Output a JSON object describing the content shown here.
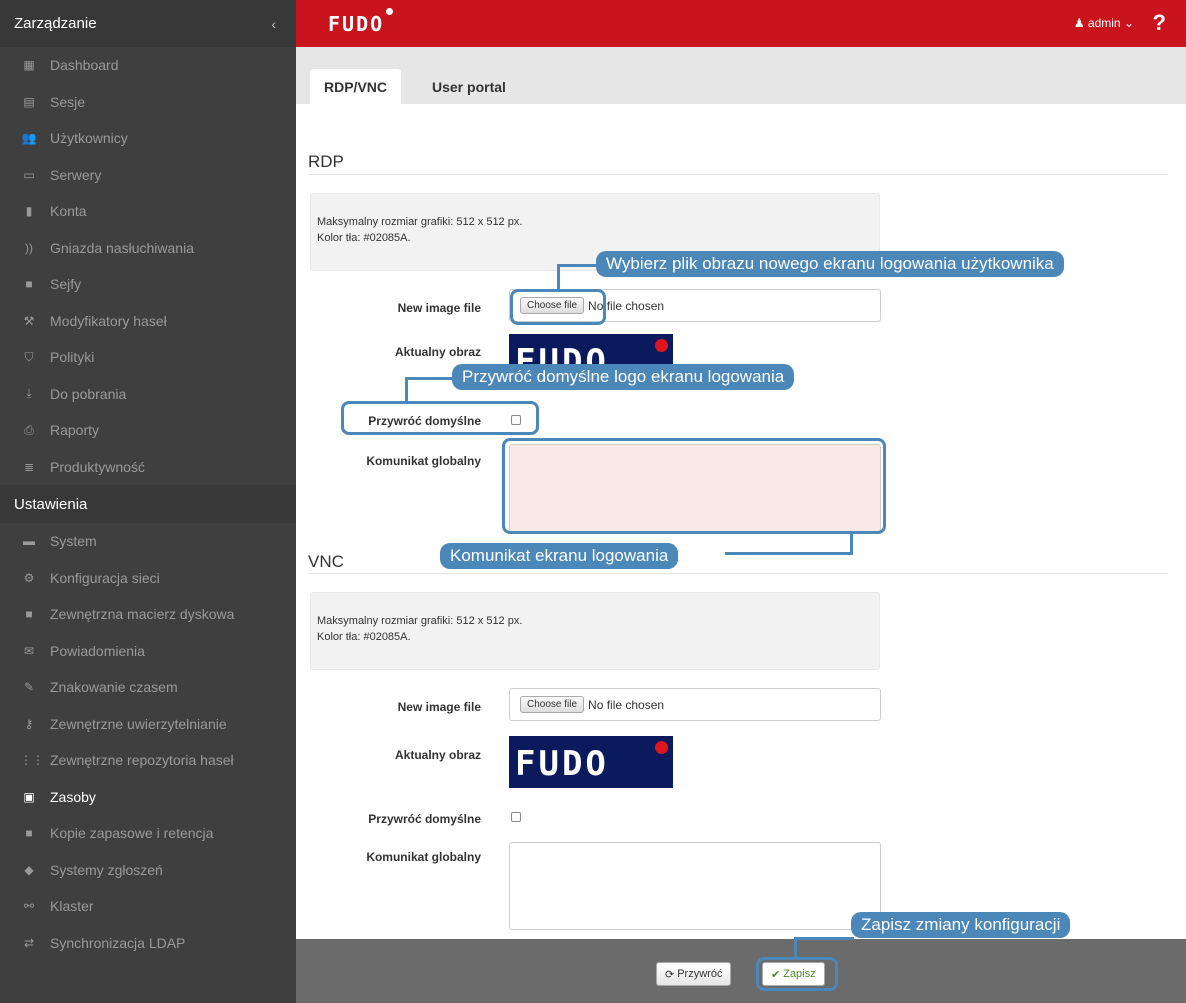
{
  "sidebar": {
    "header": "Zarządzanie",
    "collapse_icon": "‹",
    "management_items": [
      {
        "label": "Dashboard",
        "icon": "▦"
      },
      {
        "label": "Sesje",
        "icon": "▤"
      },
      {
        "label": "Użytkownicy",
        "icon": "👥"
      },
      {
        "label": "Serwery",
        "icon": "▭"
      },
      {
        "label": "Konta",
        "icon": "▮"
      },
      {
        "label": "Gniazda nasłuchiwania",
        "icon": "))"
      },
      {
        "label": "Sejfy",
        "icon": "■"
      },
      {
        "label": "Modyfikatory haseł",
        "icon": "⚒"
      },
      {
        "label": "Polityki",
        "icon": "⛉"
      },
      {
        "label": "Do pobrania",
        "icon": "⤓"
      },
      {
        "label": "Raporty",
        "icon": "⎙"
      },
      {
        "label": "Produktywność",
        "icon": "≣"
      }
    ],
    "settings_header": "Ustawienia",
    "settings_items": [
      {
        "label": "System",
        "icon": "▬"
      },
      {
        "label": "Konfiguracja sieci",
        "icon": "⚙"
      },
      {
        "label": "Zewnętrzna macierz dyskowa",
        "icon": "■"
      },
      {
        "label": "Powiadomienia",
        "icon": "✉"
      },
      {
        "label": "Znakowanie czasem",
        "icon": "✎"
      },
      {
        "label": "Zewnętrzne uwierzytelnianie",
        "icon": "⚷"
      },
      {
        "label": "Zewnętrzne repozytoria haseł",
        "icon": "⋮⋮"
      },
      {
        "label": "Zasoby",
        "icon": "▣"
      },
      {
        "label": "Kopie zapasowe i retencja",
        "icon": "■"
      },
      {
        "label": "Systemy zgłoszeń",
        "icon": "◆"
      },
      {
        "label": "Klaster",
        "icon": "⚯"
      },
      {
        "label": "Synchronizacja LDAP",
        "icon": "⇄"
      }
    ]
  },
  "topbar": {
    "logo": "FUDO",
    "user": "♟ admin ⌄",
    "help": "?"
  },
  "tabs": [
    {
      "label": "RDP/VNC"
    },
    {
      "label": "User portal"
    }
  ],
  "rdp": {
    "title": "RDP",
    "info_line1": "Maksymalny rozmiar grafiki: 512 x 512 px.",
    "info_line2": "Kolor tła: #02085A.",
    "new_image_label": "New image file",
    "choose_file": "Choose file",
    "no_file": "No file chosen",
    "current_image_label": "Aktualny obraz",
    "restore_label": "Przywróć domyślne",
    "global_msg_label": "Komunikat globalny"
  },
  "vnc": {
    "title": "VNC",
    "info_line1": "Maksymalny rozmiar grafiki: 512 x 512 px.",
    "info_line2": "Kolor tła: #02085A.",
    "new_image_label": "New image file",
    "choose_file": "Choose file",
    "no_file": "No file chosen",
    "current_image_label": "Aktualny obraz",
    "restore_label": "Przywróć domyślne",
    "global_msg_label": "Komunikat globalny"
  },
  "logo_image_text": "FUDO",
  "footer": {
    "reset_label": "Przywróć",
    "save_label": "Zapisz",
    "reset_icon": "⟳",
    "save_icon": "✔"
  },
  "callouts": {
    "choose_file": "Wybierz plik obrazu nowego ekranu logowania użytkownika",
    "restore_default": "Przywróć domyślne logo ekranu logowania",
    "login_message": "Komunikat ekranu logowania",
    "save_changes": "Zapisz zmiany konfiguracji"
  },
  "colors": {
    "brand_red": "#c9141e",
    "sidebar_bg": "#3f3f3f",
    "callout_blue": "#4b87b9",
    "logo_bg": "#02085A"
  }
}
